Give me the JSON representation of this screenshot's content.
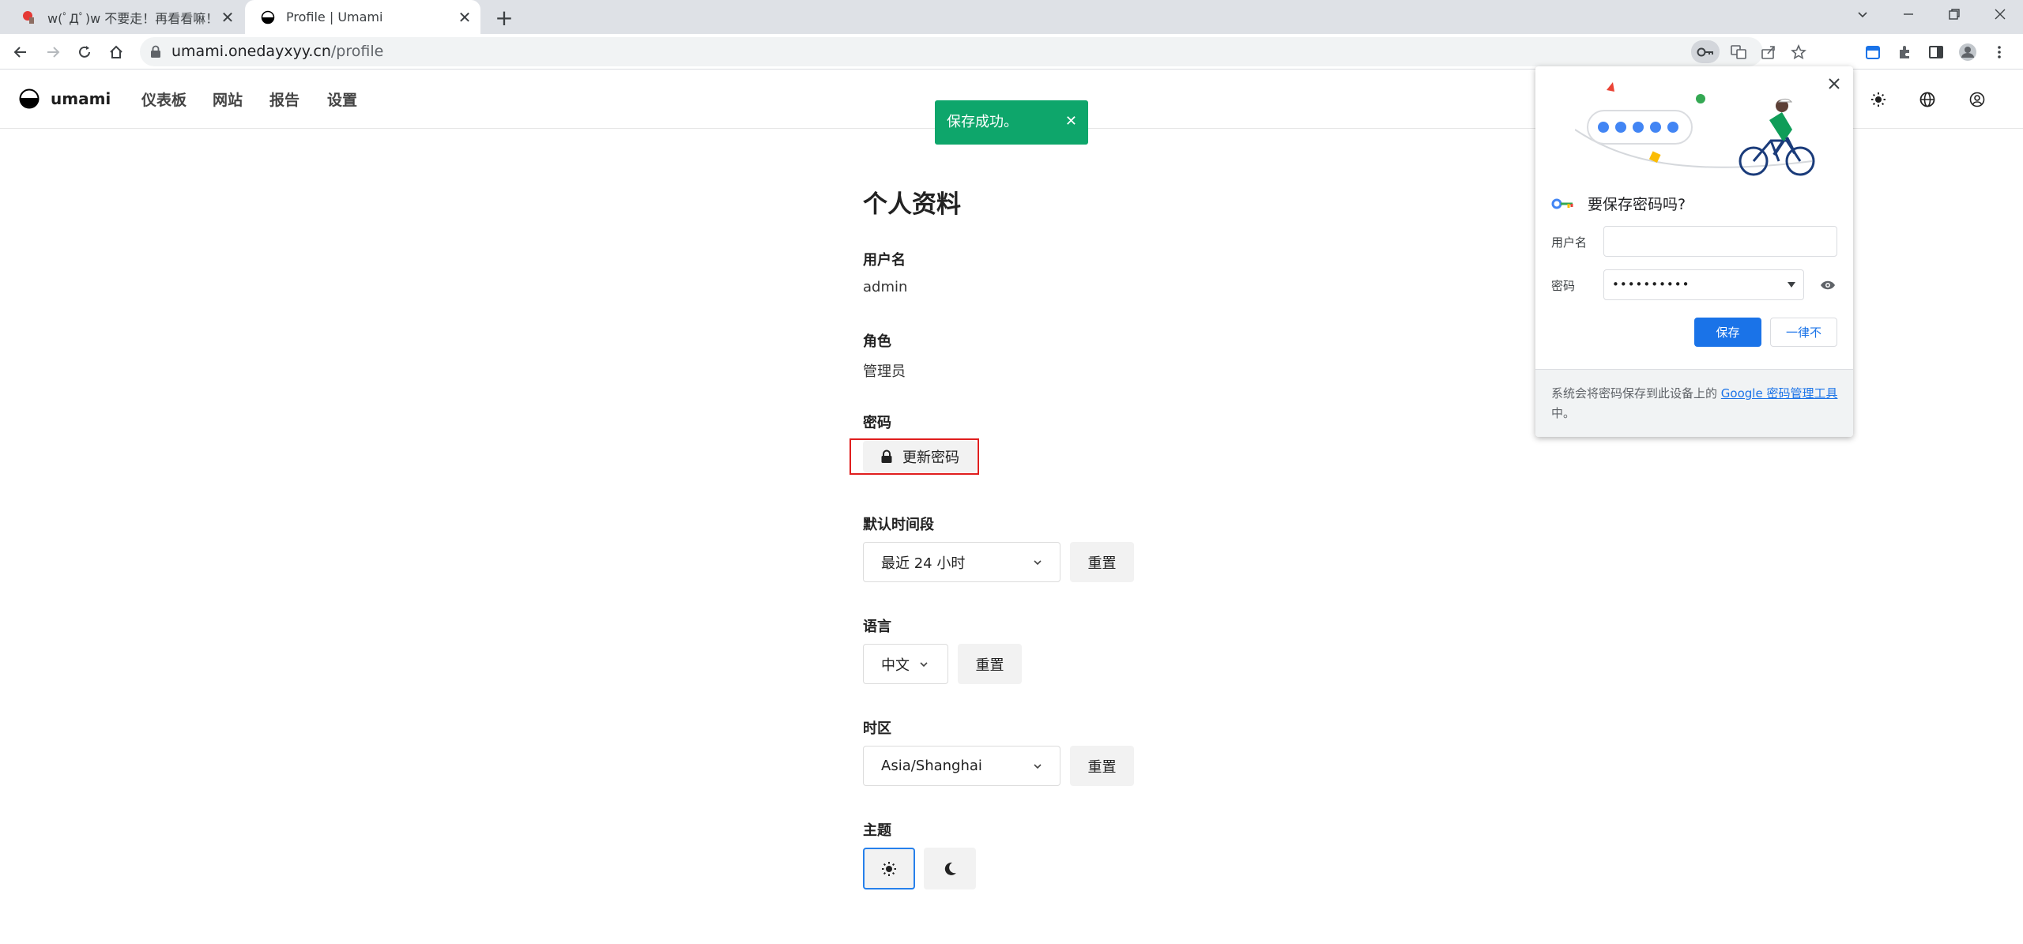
{
  "browser": {
    "tabs": [
      {
        "title": "w(ﾟДﾟ)w 不要走！再看看嘛！",
        "close": "✕",
        "active": false
      },
      {
        "title": "Profile | Umami",
        "close": "✕",
        "active": true
      }
    ],
    "new_tab": "+",
    "url_host": "umami.onedayxyy.cn",
    "url_path": "/profile"
  },
  "app": {
    "brand": "umami",
    "nav": [
      "仪表板",
      "网站",
      "报告",
      "设置"
    ]
  },
  "toast": {
    "message": "保存成功。",
    "close": "✕",
    "color": "#0ea66b"
  },
  "profile": {
    "title": "个人资料",
    "username_label": "用户名",
    "username_value": "admin",
    "role_label": "角色",
    "role_value": "管理员",
    "password_label": "密码",
    "update_password_button": "更新密码",
    "date_range_label": "默认时间段",
    "date_range_value": "最近 24 小时",
    "date_range_reset": "重置",
    "language_label": "语言",
    "language_value": "中文",
    "language_reset": "重置",
    "timezone_label": "时区",
    "timezone_value": "Asia/Shanghai",
    "timezone_reset": "重置",
    "theme_label": "主题",
    "theme_selected": "light"
  },
  "password_popup": {
    "title": "要保存密码吗?",
    "username_label": "用户名",
    "username_value": "",
    "password_label": "密码",
    "password_value": "••••••••••",
    "save_button": "保存",
    "never_button": "一律不",
    "footer_prefix": "系统会将密码保存到此设备上的",
    "footer_link": "Google 密码管理工具",
    "footer_suffix": "中。",
    "accent": "#1a73e8"
  }
}
